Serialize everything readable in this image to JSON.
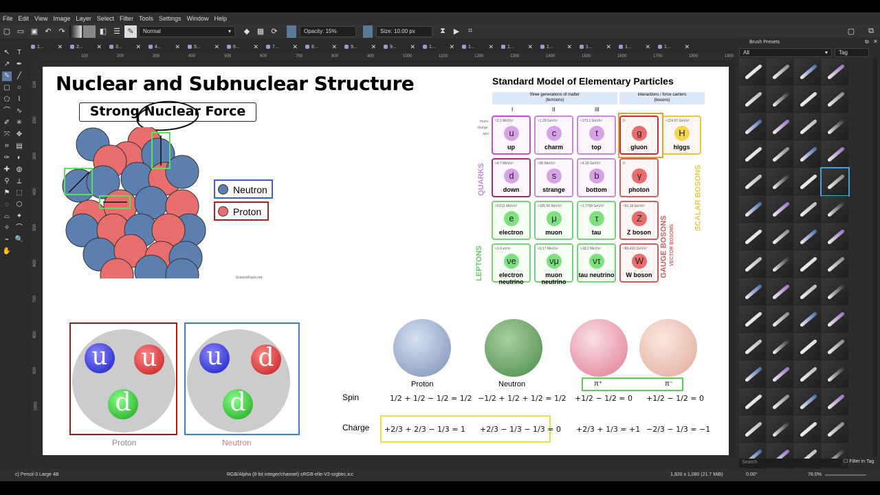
{
  "app": {
    "menu": [
      "File",
      "Edit",
      "View",
      "Image",
      "Layer",
      "Select",
      "Filter",
      "Tools",
      "Settings",
      "Window",
      "Help"
    ]
  },
  "toolbar": {
    "blend_mode": "Normal",
    "opacity": "Opacity: 15%",
    "size": "Size: 10.00 px"
  },
  "tabs": [
    "1...",
    "2...",
    "3...",
    "4...",
    "5...",
    "6...",
    "7...",
    "8...",
    "9...",
    "9...",
    "1...",
    "1...",
    "1...",
    "1...",
    "1...",
    "1...",
    "1..."
  ],
  "ruler_h": [
    "100",
    "200",
    "300",
    "400",
    "500",
    "600",
    "700",
    "800",
    "900",
    "1000",
    "1100",
    "1200",
    "1300",
    "1400",
    "1500",
    "1600",
    "1700",
    "1800",
    "1900"
  ],
  "ruler_v": [
    "100",
    "200",
    "300",
    "400",
    "500",
    "600",
    "700",
    "800",
    "900",
    "1000"
  ],
  "docker": {
    "title": "Brush Presets",
    "filter": "All",
    "tag": "Tag",
    "search_placeholder": "Search",
    "filter_in_tag": "Filter in Tag"
  },
  "status": {
    "brush": "c) Pencil-3 Large 4B",
    "color": "RGB/Alpha (8-bit integer/channel)  sRGB-elle-V2-srgbtrc.icc",
    "dims": "1,920 x 1,080 (21.7 MiB)",
    "rotation": "0.00°",
    "zoom": "78.0%"
  },
  "canvas": {
    "title": "Nuclear and Subnuclear Structure",
    "subtitle": "Strong Nuclear Force",
    "legend": {
      "neutron": "Neutron",
      "proton": "Proton"
    },
    "credit": "ScienceFacts.net",
    "sm": {
      "title": "Standard Model of Elementary Particles",
      "fermions_header": "three generations of matter\n(fermions)",
      "bosons_header": "interactions / force carriers\n(bosons)",
      "gens": [
        "I",
        "II",
        "III"
      ],
      "row_labels": [
        "mass",
        "charge",
        "spin"
      ],
      "quarks": "QUARKS",
      "leptons": "LEPTONS",
      "gauge": "GAUGE BOSONS",
      "vector": "VECTOR BOSONS",
      "scalar": "SCALAR BOSONS",
      "cells": [
        {
          "sym": "u",
          "name": "up",
          "mass": "≈2.2 MeV/c²",
          "color": "#c44ec8",
          "ball": "#d8a2e6"
        },
        {
          "sym": "c",
          "name": "charm",
          "mass": "≈1.28 GeV/c²",
          "color": "#c88ad8",
          "ball": "#d8a2e6"
        },
        {
          "sym": "t",
          "name": "top",
          "mass": "≈173.1 GeV/c²",
          "color": "#c88ad8",
          "ball": "#d8a2e6"
        },
        {
          "sym": "g",
          "name": "gluon",
          "mass": "0",
          "color": "#c03030",
          "ball": "#e86d6d"
        },
        {
          "sym": "H",
          "name": "higgs",
          "mass": "≈124.97 GeV/c²",
          "color": "#e8c84a",
          "ball": "#f1d54d"
        },
        {
          "sym": "d",
          "name": "down",
          "mass": "≈4.7 MeV/c²",
          "color": "#a8286a",
          "ball": "#d8a2e6"
        },
        {
          "sym": "s",
          "name": "strange",
          "mass": "≈96 MeV/c²",
          "color": "#c88ad8",
          "ball": "#d8a2e6"
        },
        {
          "sym": "b",
          "name": "bottom",
          "mass": "≈4.18 GeV/c²",
          "color": "#c88ad8",
          "ball": "#d8a2e6"
        },
        {
          "sym": "γ",
          "name": "photon",
          "mass": "0",
          "color": "#d06060",
          "ball": "#e86d6d"
        },
        {
          "sym": "e",
          "name": "electron",
          "mass": "≈0.511 MeV/c²",
          "color": "#7ad07a",
          "ball": "#7ee07e"
        },
        {
          "sym": "μ",
          "name": "muon",
          "mass": "≈105.66 MeV/c²",
          "color": "#7ad07a",
          "ball": "#7ee07e"
        },
        {
          "sym": "τ",
          "name": "tau",
          "mass": "≈1.7768 GeV/c²",
          "color": "#7ad07a",
          "ball": "#7ee07e"
        },
        {
          "sym": "Z",
          "name": "Z boson",
          "mass": "≈91.19 GeV/c²",
          "color": "#d06060",
          "ball": "#e86d6d"
        },
        {
          "sym": "νe",
          "name": "electron neutrino",
          "mass": "<1.0 eV/c²",
          "color": "#7ad07a",
          "ball": "#7ee07e"
        },
        {
          "sym": "νμ",
          "name": "muon neutrino",
          "mass": "<0.17 MeV/c²",
          "color": "#7ad07a",
          "ball": "#7ee07e"
        },
        {
          "sym": "ντ",
          "name": "tau neutrino",
          "mass": "<18.2 MeV/c²",
          "color": "#7ad07a",
          "ball": "#7ee07e"
        },
        {
          "sym": "W",
          "name": "W boson",
          "mass": "≈80.433 GeV/c²",
          "color": "#d06060",
          "ball": "#e86d6d"
        }
      ]
    },
    "hadrons": [
      {
        "label": "Proton",
        "q": [
          "u",
          "u",
          "d"
        ]
      },
      {
        "label": "Neutron",
        "q": [
          "u",
          "d",
          "d"
        ]
      }
    ],
    "qcd": {
      "proton": "Proton",
      "neutron": "Neutron",
      "pi_plus": "π⁺",
      "pi_minus": "π⁻",
      "spin": "Spin",
      "charge": "Charge",
      "spin_eqs": [
        "1/2 + 1/2 − 1/2 = 1/2",
        "−1/2 + 1/2 + 1/2 = 1/2",
        "+1/2 − 1/2 = 0",
        "+1/2 − 1/2 = 0"
      ],
      "charge_eqs": [
        "+2/3 + 2/3 − 1/3 = 1",
        "+2/3 − 1/3 − 1/3 = 0",
        "+2/3 + 1/3 = +1",
        "−2/3 − 1/3 = −1"
      ]
    }
  }
}
